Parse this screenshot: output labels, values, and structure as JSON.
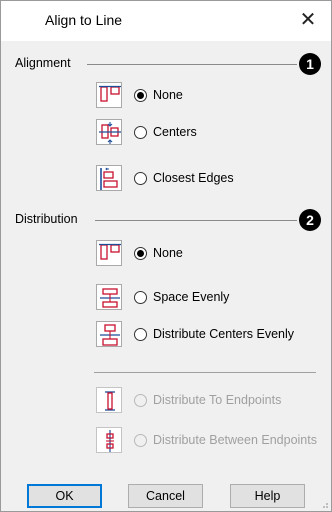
{
  "window": {
    "title": "Align to Line",
    "close_glyph": "✕"
  },
  "alignment": {
    "label": "Alignment",
    "badge": "1",
    "options": [
      {
        "label": "None",
        "checked": true,
        "icon": "align-none-icon"
      },
      {
        "label": "Centers",
        "checked": false,
        "icon": "align-centers-icon"
      },
      {
        "label": "Closest Edges",
        "checked": false,
        "icon": "align-edges-icon"
      }
    ]
  },
  "distribution": {
    "label": "Distribution",
    "badge": "2",
    "options": [
      {
        "label": "None",
        "checked": true,
        "icon": "distribute-none-icon"
      },
      {
        "label": "Space Evenly",
        "checked": false,
        "icon": "space-evenly-icon"
      },
      {
        "label": "Distribute Centers Evenly",
        "checked": false,
        "icon": "distribute-centers-icon"
      }
    ],
    "disabled_options": [
      {
        "label": "Distribute To Endpoints",
        "icon": "endpoints-icon"
      },
      {
        "label": "Distribute Between Endpoints",
        "icon": "between-endpoints-icon"
      }
    ]
  },
  "buttons": {
    "ok": "OK",
    "cancel": "Cancel",
    "help": "Help"
  },
  "colors": {
    "icon_red": "#c8102e",
    "icon_blue": "#1f4e99",
    "accent": "#0078d7"
  }
}
